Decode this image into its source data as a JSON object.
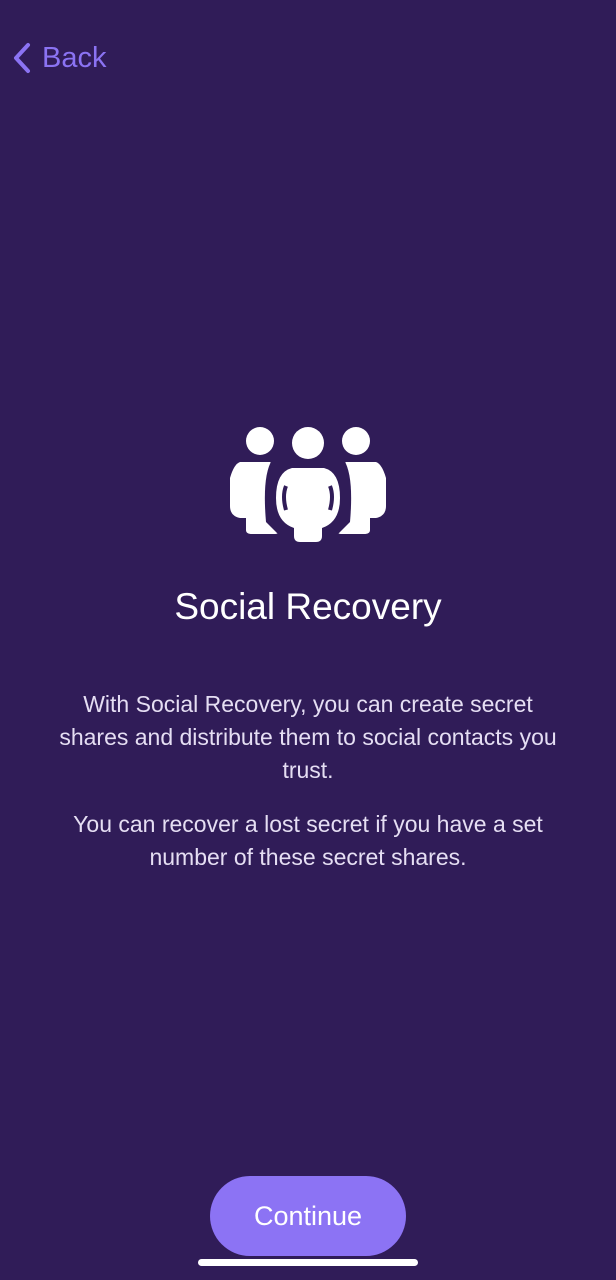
{
  "nav": {
    "back_label": "Back"
  },
  "hero": {
    "icon": "people-group-icon"
  },
  "content": {
    "title": "Social Recovery",
    "paragraph_1": "With Social Recovery, you can create secret shares and distribute them to social contacts you trust.",
    "paragraph_2": "You can recover a lost secret if you have a set number of these secret shares."
  },
  "actions": {
    "continue_label": "Continue"
  },
  "colors": {
    "background": "#301C58",
    "accent": "#8C73F4",
    "text": "#FFFFFF"
  }
}
